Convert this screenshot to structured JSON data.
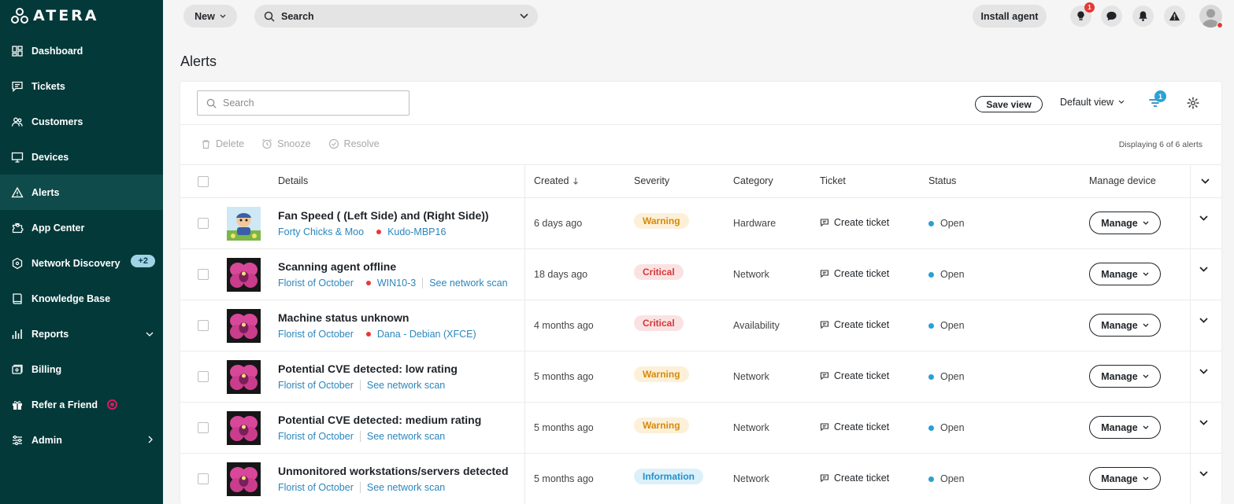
{
  "app": {
    "logo": "ATERA"
  },
  "sidebar": {
    "items": [
      {
        "label": "Dashboard",
        "icon": "dashboard-icon"
      },
      {
        "label": "Tickets",
        "icon": "tickets-icon"
      },
      {
        "label": "Customers",
        "icon": "customers-icon"
      },
      {
        "label": "Devices",
        "icon": "devices-icon"
      },
      {
        "label": "Alerts",
        "icon": "alerts-icon",
        "active": true
      },
      {
        "label": "App Center",
        "icon": "app-center-icon"
      },
      {
        "label": "Network Discovery",
        "icon": "network-discovery-icon",
        "badge": "+2"
      },
      {
        "label": "Knowledge Base",
        "icon": "knowledge-base-icon"
      },
      {
        "label": "Reports",
        "icon": "reports-icon"
      },
      {
        "label": "Billing",
        "icon": "billing-icon"
      },
      {
        "label": "Refer a Friend",
        "icon": "gift-icon"
      },
      {
        "label": "Admin",
        "icon": "admin-icon"
      }
    ]
  },
  "topbar": {
    "new_label": "New",
    "search_label": "Search",
    "install_label": "Install agent",
    "tips_badge": "1"
  },
  "page": {
    "title": "Alerts"
  },
  "toolbar": {
    "search_placeholder": "Search",
    "save_view": "Save view",
    "default_view": "Default view",
    "filter_count": "1",
    "delete": "Delete",
    "snooze": "Snooze",
    "resolve": "Resolve",
    "displaying": "Displaying 6 of 6 alerts"
  },
  "columns": {
    "details": "Details",
    "created": "Created",
    "severity": "Severity",
    "category": "Category",
    "ticket": "Ticket",
    "status": "Status",
    "manage": "Manage device"
  },
  "rows": [
    {
      "title": "Fan Speed ( (Left Side) and (Right Side))",
      "customer": "Forty Chicks & Moo",
      "device": "Kudo-MBP16",
      "scan": "",
      "created": "6 days ago",
      "severity": "Warning",
      "category": "Hardware",
      "ticket": "Create ticket",
      "status": "Open",
      "manage": "Manage",
      "thumb": "cartoon"
    },
    {
      "title": "Scanning agent offline",
      "customer": "Florist of October",
      "device": "WIN10-3",
      "scan": "See network scan",
      "created": "18 days ago",
      "severity": "Critical",
      "category": "Network",
      "ticket": "Create ticket",
      "status": "Open",
      "manage": "Manage",
      "thumb": "orchid"
    },
    {
      "title": "Machine status unknown",
      "customer": "Florist of October",
      "device": "Dana - Debian (XFCE)",
      "scan": "",
      "created": "4 months ago",
      "severity": "Critical",
      "category": "Availability",
      "ticket": "Create ticket",
      "status": "Open",
      "manage": "Manage",
      "thumb": "orchid"
    },
    {
      "title": "Potential CVE detected: low rating",
      "customer": "Florist of October",
      "device": "",
      "scan": "See network scan",
      "created": "5 months ago",
      "severity": "Warning",
      "category": "Network",
      "ticket": "Create ticket",
      "status": "Open",
      "manage": "Manage",
      "thumb": "orchid"
    },
    {
      "title": "Potential CVE detected: medium rating",
      "customer": "Florist of October",
      "device": "",
      "scan": "See network scan",
      "created": "5 months ago",
      "severity": "Warning",
      "category": "Network",
      "ticket": "Create ticket",
      "status": "Open",
      "manage": "Manage",
      "thumb": "orchid"
    },
    {
      "title": "Unmonitored workstations/servers detected",
      "customer": "Florist of October",
      "device": "",
      "scan": "See network scan",
      "created": "5 months ago",
      "severity": "Information",
      "category": "Network",
      "ticket": "Create ticket",
      "status": "Open",
      "manage": "Manage",
      "thumb": "orchid"
    }
  ],
  "colors": {
    "sidebar_bg": "#04393a",
    "link": "#2a86bd",
    "warning": "#d48a0c",
    "critical": "#d33838",
    "information": "#268fc6",
    "status_open": "#2a9fd6"
  }
}
